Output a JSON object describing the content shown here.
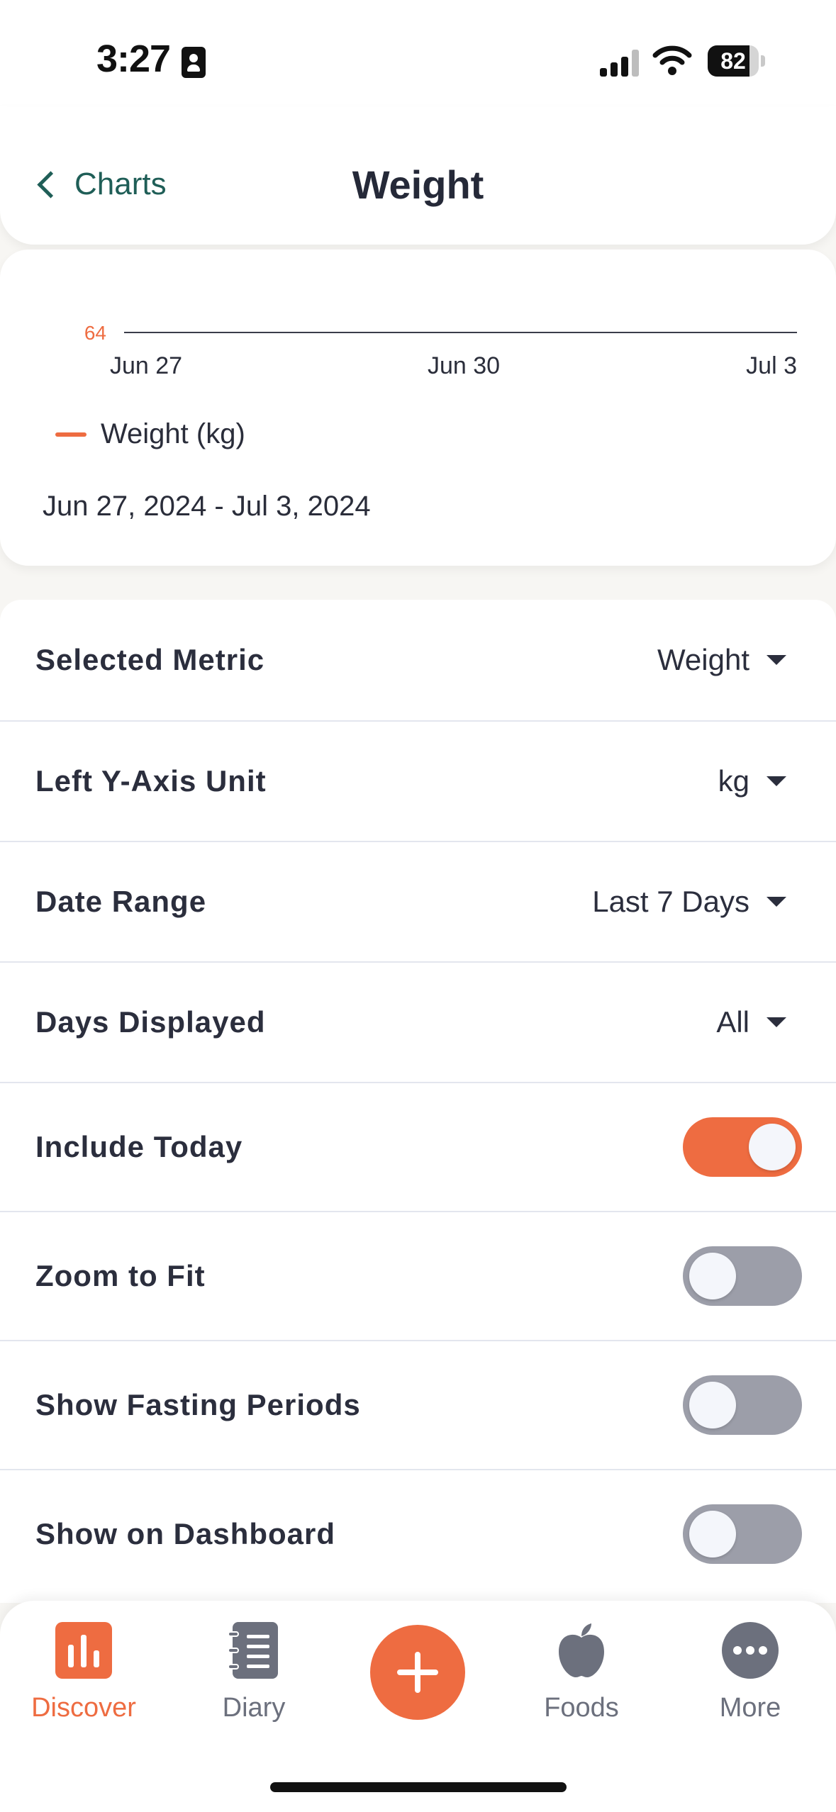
{
  "status_bar": {
    "time": "3:27",
    "battery": "82",
    "battery_level": 0.82
  },
  "header": {
    "back_label": "Charts",
    "title": "Weight"
  },
  "chart_data": {
    "type": "line",
    "y_tick": "64",
    "x_ticks": [
      "Jun 27",
      "Jun 30",
      "Jul 3"
    ],
    "series": [
      {
        "name": "Weight (kg)",
        "color": "#ee6c41",
        "values": []
      }
    ],
    "grid": true
  },
  "chart": {
    "date_range_text": "Jun 27, 2024 - Jul 3, 2024"
  },
  "settings": {
    "selected_metric": {
      "label": "Selected Metric",
      "value": "Weight"
    },
    "left_y_axis_unit": {
      "label": "Left Y-Axis Unit",
      "value": "kg"
    },
    "date_range": {
      "label": "Date Range",
      "value": "Last 7 Days"
    },
    "days_displayed": {
      "label": "Days Displayed",
      "value": "All"
    },
    "include_today": {
      "label": "Include Today",
      "on": true
    },
    "zoom_to_fit": {
      "label": "Zoom to Fit",
      "on": false
    },
    "show_fasting_periods": {
      "label": "Show Fasting Periods",
      "on": false
    },
    "show_on_dashboard": {
      "label": "Show on Dashboard",
      "on": false
    }
  },
  "bottom_nav": {
    "discover": {
      "label": "Discover",
      "icon": "bar-chart-icon",
      "active": true
    },
    "diary": {
      "label": "Diary",
      "icon": "notebook-icon"
    },
    "add": {
      "icon": "plus-icon"
    },
    "foods": {
      "label": "Foods",
      "icon": "apple-icon"
    },
    "more": {
      "label": "More",
      "icon": "ellipsis-icon"
    }
  },
  "colors": {
    "accent": "#ee6c41",
    "toggle_off": "#9c9ea9",
    "back_link": "#1f5e57",
    "nav_inactive": "#6c707d"
  }
}
